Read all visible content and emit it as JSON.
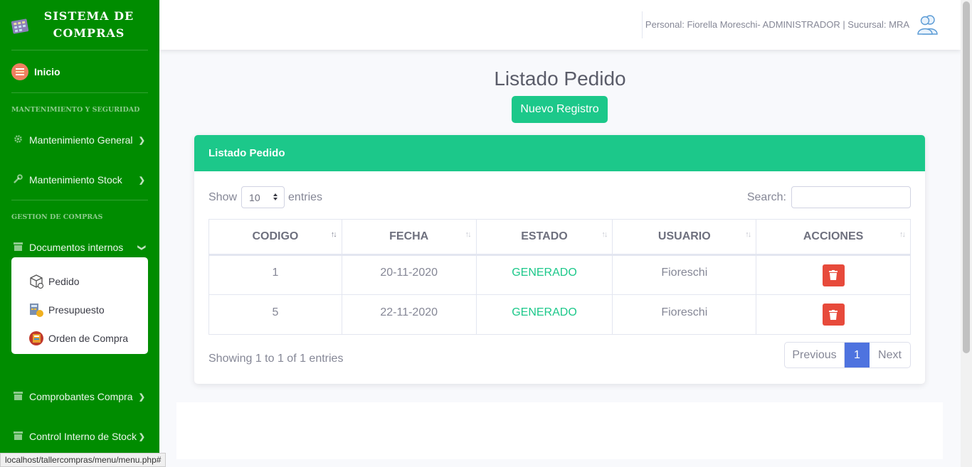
{
  "brand": {
    "title": "SISTEMA DE COMPRAS"
  },
  "sidebar": {
    "home": "Inicio",
    "sections": [
      {
        "heading": "MANTENIMIENTO Y SEGURIDAD"
      },
      {
        "heading": "GESTION DE COMPRAS"
      }
    ],
    "items": [
      {
        "label": "Mantenimiento General",
        "icon": "gear-icon"
      },
      {
        "label": "Mantenimiento Stock",
        "icon": "wrench-icon"
      },
      {
        "label": "Documentos internos",
        "icon": "archive-icon"
      },
      {
        "label": "Comprobantes Compra",
        "icon": "archive-icon"
      },
      {
        "label": "Control Interno de Stock",
        "icon": "archive-icon"
      }
    ],
    "submenu": [
      {
        "label": "Pedido",
        "icon": "package-icon"
      },
      {
        "label": "Presupuesto",
        "icon": "budget-icon"
      },
      {
        "label": "Orden de Compra",
        "icon": "order-icon"
      }
    ]
  },
  "topbar": {
    "user_text": "Personal: Fiorella Moreschi- ADMINISTRADOR | Sucursal: MRA"
  },
  "page": {
    "title": "Listado Pedido",
    "new_button": "Nuevo Registro"
  },
  "card": {
    "header": "Listado Pedido",
    "show_label": "Show",
    "entries_value": "10",
    "entries_label": "entries",
    "search_label": "Search:",
    "search_value": "",
    "columns": [
      "CODIGO",
      "FECHA",
      "ESTADO",
      "USUARIO",
      "ACCIONES"
    ],
    "rows": [
      {
        "codigo": "1",
        "fecha": "20-11-2020",
        "estado": "GENERADO",
        "usuario": "Fioreschi"
      },
      {
        "codigo": "5",
        "fecha": "22-11-2020",
        "estado": "GENERADO",
        "usuario": "Fioreschi"
      }
    ],
    "showing": "Showing 1 to 1 of 1 entries",
    "pagination": {
      "previous": "Previous",
      "current": "1",
      "next": "Next"
    }
  },
  "status_bar": {
    "url": "localhost/tallercompras/menu/menu.php#"
  },
  "colors": {
    "sidebar": "#008c00",
    "accent": "#1cc88a",
    "danger": "#e74a3b",
    "primary": "#4e73df"
  }
}
